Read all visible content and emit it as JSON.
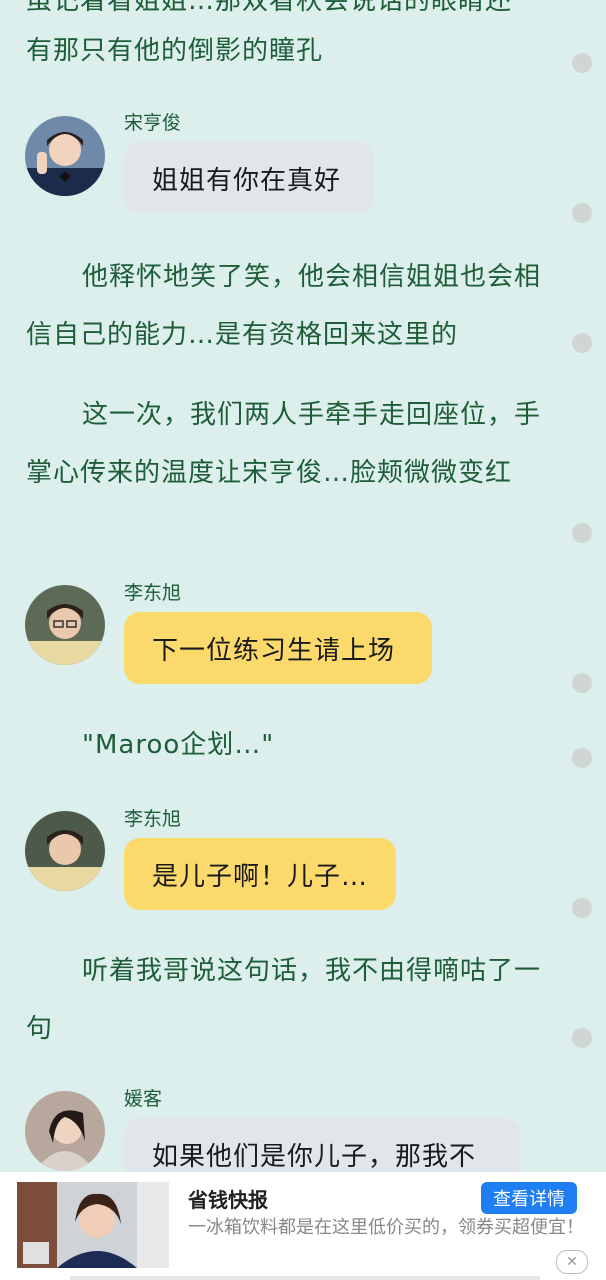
{
  "story": {
    "p0_line1": "虽记着看姐姐…那双看秋会说话的眼睛还",
    "p0_line2": "有那只有他的倒影的瞳孔",
    "p1": "他释怀地笑了笑，他会相信姐姐也会相信自己的能力…是有资格回来这里的",
    "p2": "这一次，我们两人手牵手走回座位，手掌心传来的温度让宋亨俊…脸颊微微变红",
    "p3": "\"Maroo企划…\"",
    "p4": "听着我哥说这句话，我不由得嘀咕了一句"
  },
  "messages": [
    {
      "speaker": "宋亨俊",
      "text": "姐姐有你在真好",
      "style": "gray"
    },
    {
      "speaker": "李东旭",
      "text": "下一位练习生请上场",
      "style": "yellow"
    },
    {
      "speaker": "李东旭",
      "text": "是儿子啊！儿子…",
      "style": "yellow"
    },
    {
      "speaker": "媛客",
      "text": "如果他们是你儿子，那我不",
      "style": "gray"
    }
  ],
  "ad": {
    "title": "省钱快报",
    "description": "一冰箱饮料都是在这里低价买的，领券买超便宜！",
    "button": "查看详情",
    "close": "✕"
  },
  "colors": {
    "background": "#dcefec",
    "narration_text": "#1e5d38",
    "bubble_gray": "#e1e6ea",
    "bubble_yellow": "#fcd96b",
    "ad_button": "#1e7ef2"
  }
}
